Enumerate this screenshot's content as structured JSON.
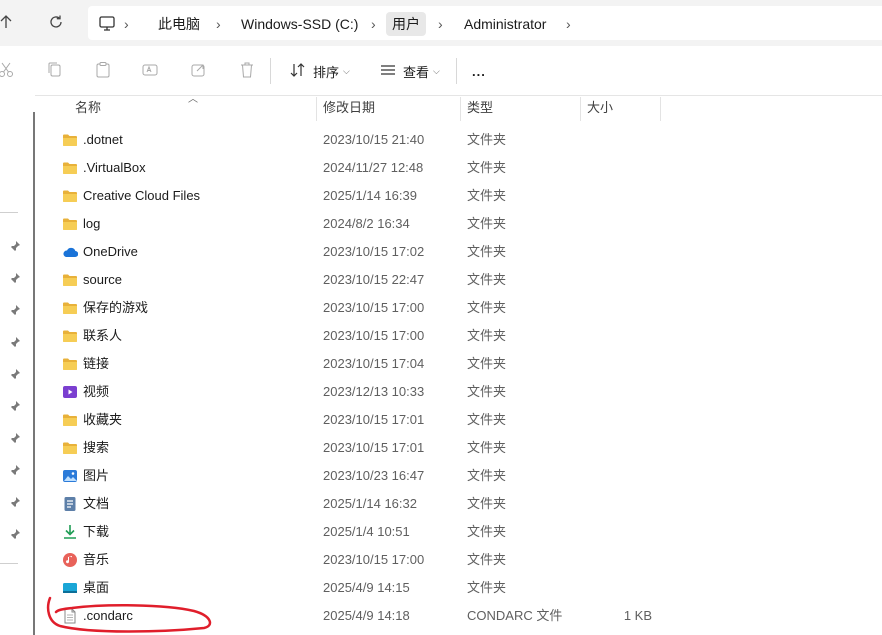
{
  "address": {
    "crumbs": [
      "此电脑",
      "Windows-SSD (C:)",
      "用户",
      "Administrator"
    ]
  },
  "toolbar": {
    "sort_label": "排序",
    "view_label": "查看",
    "more_label": "..."
  },
  "columns": {
    "name": "名称",
    "date": "修改日期",
    "type": "类型",
    "size": "大小"
  },
  "files": [
    {
      "name": ".dotnet",
      "date": "2023/10/15 21:40",
      "type": "文件夹",
      "size": "",
      "icon": "folder-icon"
    },
    {
      "name": ".VirtualBox",
      "date": "2024/11/27 12:48",
      "type": "文件夹",
      "size": "",
      "icon": "folder-icon"
    },
    {
      "name": "Creative Cloud Files",
      "date": "2025/1/14 16:39",
      "type": "文件夹",
      "size": "",
      "icon": "folder-icon"
    },
    {
      "name": "log",
      "date": "2024/8/2 16:34",
      "type": "文件夹",
      "size": "",
      "icon": "folder-icon"
    },
    {
      "name": "OneDrive",
      "date": "2023/10/15 17:02",
      "type": "文件夹",
      "size": "",
      "icon": "onedrive-cloud-icon"
    },
    {
      "name": "source",
      "date": "2023/10/15 22:47",
      "type": "文件夹",
      "size": "",
      "icon": "folder-icon"
    },
    {
      "name": "保存的游戏",
      "date": "2023/10/15 17:00",
      "type": "文件夹",
      "size": "",
      "icon": "folder-icon"
    },
    {
      "name": "联系人",
      "date": "2023/10/15 17:00",
      "type": "文件夹",
      "size": "",
      "icon": "folder-icon"
    },
    {
      "name": "链接",
      "date": "2023/10/15 17:04",
      "type": "文件夹",
      "size": "",
      "icon": "folder-icon"
    },
    {
      "name": "视频",
      "date": "2023/12/13 10:33",
      "type": "文件夹",
      "size": "",
      "icon": "video-folder-icon"
    },
    {
      "name": "收藏夹",
      "date": "2023/10/15 17:01",
      "type": "文件夹",
      "size": "",
      "icon": "folder-icon"
    },
    {
      "name": "搜索",
      "date": "2023/10/15 17:01",
      "type": "文件夹",
      "size": "",
      "icon": "folder-icon"
    },
    {
      "name": "图片",
      "date": "2023/10/23 16:47",
      "type": "文件夹",
      "size": "",
      "icon": "pictures-folder-icon"
    },
    {
      "name": "文档",
      "date": "2025/1/14 16:32",
      "type": "文件夹",
      "size": "",
      "icon": "documents-folder-icon"
    },
    {
      "name": "下载",
      "date": "2025/1/4 10:51",
      "type": "文件夹",
      "size": "",
      "icon": "downloads-folder-icon"
    },
    {
      "name": "音乐",
      "date": "2023/10/15 17:00",
      "type": "文件夹",
      "size": "",
      "icon": "music-folder-icon"
    },
    {
      "name": "桌面",
      "date": "2025/4/9 14:15",
      "type": "文件夹",
      "size": "",
      "icon": "desktop-folder-icon"
    },
    {
      "name": ".condarc",
      "date": "2025/4/9 14:18",
      "type": "CONDARC 文件",
      "size": "1 KB",
      "icon": "file-icon"
    }
  ],
  "colors": {
    "folder": "#f4c542",
    "annotation": "#e01e2b",
    "address_bg": "#f3f3f3"
  }
}
